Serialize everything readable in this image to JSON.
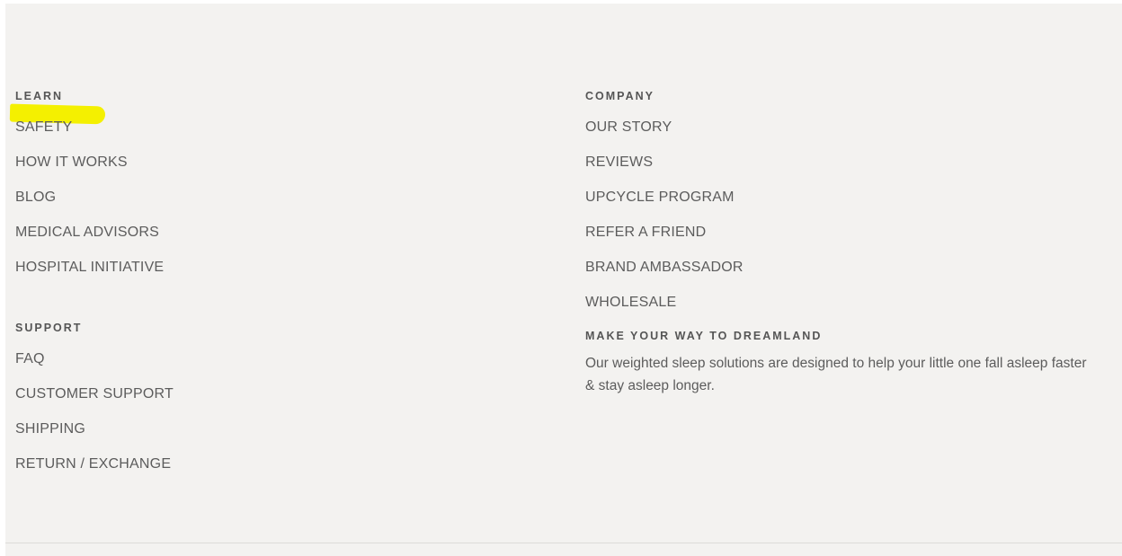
{
  "learn": {
    "heading": "LEARN",
    "links": [
      {
        "label": "SAFETY"
      },
      {
        "label": "HOW IT WORKS"
      },
      {
        "label": "BLOG"
      },
      {
        "label": "MEDICAL ADVISORS"
      },
      {
        "label": "HOSPITAL INITIATIVE"
      }
    ]
  },
  "support": {
    "heading": "SUPPORT",
    "links": [
      {
        "label": "FAQ"
      },
      {
        "label": "CUSTOMER SUPPORT"
      },
      {
        "label": "SHIPPING"
      },
      {
        "label": "RETURN / EXCHANGE"
      }
    ]
  },
  "company": {
    "heading": "COMPANY",
    "links": [
      {
        "label": "OUR STORY"
      },
      {
        "label": "REVIEWS"
      },
      {
        "label": "UPCYCLE PROGRAM"
      },
      {
        "label": "REFER A FRIEND"
      },
      {
        "label": "BRAND AMBASSADOR"
      },
      {
        "label": "WHOLESALE"
      }
    ]
  },
  "tagline": {
    "heading": "MAKE YOUR WAY TO DREAMLAND",
    "text": "Our weighted sleep solutions are designed to help your little one fall asleep faster & stay asleep longer."
  },
  "colors": {
    "background": "#f3f2f0",
    "text": "#5c5c5c",
    "highlight": "#f4f000"
  }
}
